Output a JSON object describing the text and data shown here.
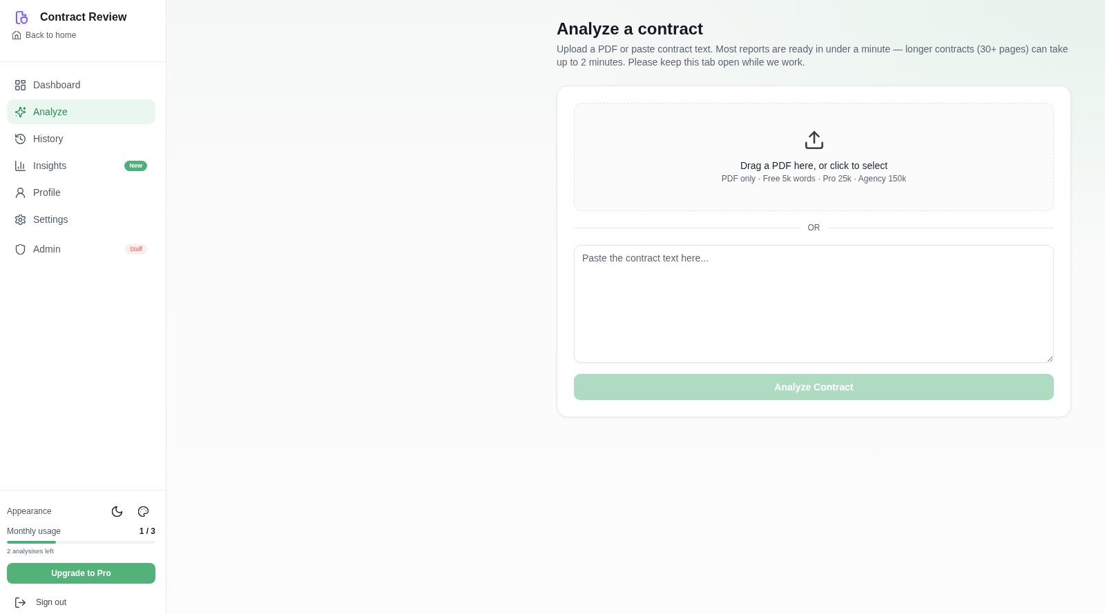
{
  "app": {
    "title": "Contract Review",
    "back_link": "Back to home"
  },
  "sidebar": {
    "items": [
      {
        "label": "Dashboard",
        "selected": false
      },
      {
        "label": "Analyze",
        "selected": true
      },
      {
        "label": "History",
        "selected": false
      },
      {
        "label": "Insights",
        "selected": false,
        "badge": {
          "text": "New",
          "kind": "new"
        }
      },
      {
        "label": "Profile",
        "selected": false
      },
      {
        "label": "Settings",
        "selected": false
      },
      {
        "label": "Admin",
        "selected": false,
        "badge": {
          "text": "Staff",
          "kind": "staff"
        }
      }
    ]
  },
  "appearance": {
    "label": "Appearance"
  },
  "usage": {
    "label": "Monthly usage",
    "count": "1 / 3",
    "level": 0.33,
    "note": "2 analysises left"
  },
  "upgrade_button": {
    "label": "Upgrade to Pro"
  },
  "sign_out": {
    "label": "Sign out"
  },
  "page": {
    "title": "Analyze a contract",
    "description": "Upload a PDF or paste contract text. Most reports are ready in under a minute — longer contracts (30+ pages) can take up to 2 minutes. Please keep this tab open while we work."
  },
  "upload": {
    "title": "Drag a PDF here, or click to select",
    "hint": "PDF only · Free 5k words · Pro 25k · Agency 150k"
  },
  "divider": {
    "label": "OR"
  },
  "contract_text": {
    "placeholder": "Paste the contract text here..."
  },
  "analyze_button": {
    "label": "Analyze Contract",
    "disabled": true
  }
}
